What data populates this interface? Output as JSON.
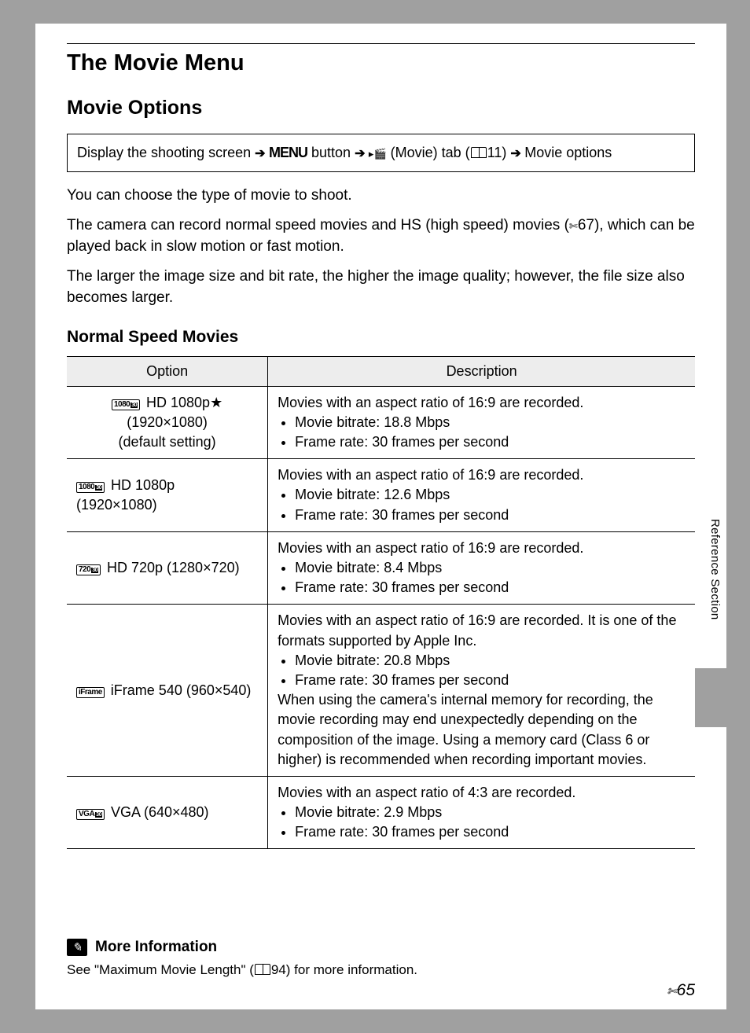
{
  "header": {
    "title": "The Movie Menu",
    "subtitle": "Movie Options"
  },
  "nav": {
    "prefix": "Display the shooting screen",
    "menu_word": "MENU",
    "button_word": " button",
    "movie_tab": "(Movie) tab (",
    "page_ref": "11)",
    "last": "Movie options"
  },
  "paragraphs": {
    "p1": "You can choose the type of movie to shoot.",
    "p2a": "The camera can record normal speed movies and HS (high speed) movies (",
    "p2b": "67), which can be played back in slow motion or fast motion.",
    "p3": "The larger the image size and bit rate, the higher the image quality; however, the file size also becomes larger."
  },
  "section_heading": "Normal Speed Movies",
  "table": {
    "headers": {
      "option": "Option",
      "description": "Description"
    },
    "rows": [
      {
        "badge_main": "1080",
        "badge_sub": "30",
        "option_line1": "HD 1080p",
        "star": "★",
        "option_line2": "(1920×1080)",
        "option_line3": "(default setting)",
        "desc_lead": "Movies with an aspect ratio of 16:9 are recorded.",
        "bullets": [
          "Movie bitrate: 18.8 Mbps",
          "Frame rate: 30 frames per second"
        ]
      },
      {
        "badge_main": "1080",
        "badge_sub": "30",
        "option_line1": "HD 1080p (1920×1080)",
        "desc_lead": "Movies with an aspect ratio of 16:9 are recorded.",
        "bullets": [
          "Movie bitrate: 12.6 Mbps",
          "Frame rate: 30 frames per second"
        ]
      },
      {
        "badge_main": "720",
        "badge_sub": "30",
        "option_line1": "HD 720p (1280×720)",
        "desc_lead": "Movies with an aspect ratio of 16:9 are recorded.",
        "bullets": [
          "Movie bitrate: 8.4 Mbps",
          "Frame rate: 30 frames per second"
        ]
      },
      {
        "badge_main": "iFrame",
        "option_line1": "iFrame 540 (960×540)",
        "desc_lead": "Movies with an aspect ratio of 16:9 are recorded. It is one of the formats supported by Apple Inc.",
        "bullets": [
          "Movie bitrate: 20.8 Mbps",
          "Frame rate: 30 frames per second"
        ],
        "desc_tail": "When using the camera's internal memory for recording, the movie recording may end unexpectedly depending on the composition of the image. Using a memory card (Class 6 or higher) is recommended when recording important movies."
      },
      {
        "badge_main": "VGA",
        "badge_sub": "30",
        "option_line1": "VGA (640×480)",
        "desc_lead": "Movies with an aspect ratio of 4:3 are recorded.",
        "bullets": [
          "Movie bitrate: 2.9 Mbps",
          "Frame rate: 30 frames per second"
        ]
      }
    ]
  },
  "side_tab": "Reference Section",
  "more_info": {
    "title": "More Information",
    "text_a": "See \"Maximum Movie Length\" (",
    "text_b": "94) for more information."
  },
  "page_number": "65"
}
